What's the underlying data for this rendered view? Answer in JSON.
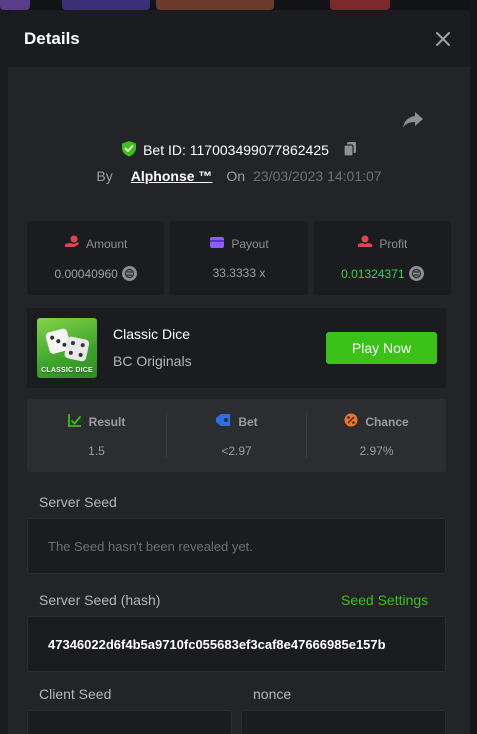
{
  "modal": {
    "title": "Details"
  },
  "bet": {
    "id_label": "Bet ID: 117003499077862425",
    "by_label": "By",
    "user": "Alphonse ™",
    "on_label": "On",
    "date": "23/03/2023 14:01:07"
  },
  "stats": [
    {
      "label": "Amount",
      "value": "0.00040960",
      "icon": "money-hand-icon",
      "icon_color": "#e0454f"
    },
    {
      "label": "Payout",
      "value": "33.3333 x",
      "icon": "wallet-icon",
      "icon_color": "#8b5cf6"
    },
    {
      "label": "Profit",
      "value": "0.01324371",
      "icon": "coins-hand-icon",
      "icon_color": "#e0454f"
    }
  ],
  "game": {
    "name": "Classic Dice",
    "provider": "BC Originals",
    "thumb_text": "CLASSIC DICE",
    "play_label": "Play Now"
  },
  "result": {
    "result_label": "Result",
    "result_value": "1.5",
    "bet_label": "Bet",
    "bet_value": "<2.97",
    "chance_label": "Chance",
    "chance_value": "2.97%"
  },
  "seeds": {
    "server_seed_label": "Server Seed",
    "server_seed_value": "The Seed hasn't been revealed yet.",
    "server_hash_label": "Server Seed (hash)",
    "seed_settings_label": "Seed Settings",
    "server_hash_value": "47346022d6f4b5a9710fc055683ef3caf8e47666985e157b",
    "client_seed_label": "Client Seed",
    "nonce_label": "nonce"
  },
  "colors": {
    "accent_green": "#3bc117",
    "profit_green": "#3fd34b"
  }
}
